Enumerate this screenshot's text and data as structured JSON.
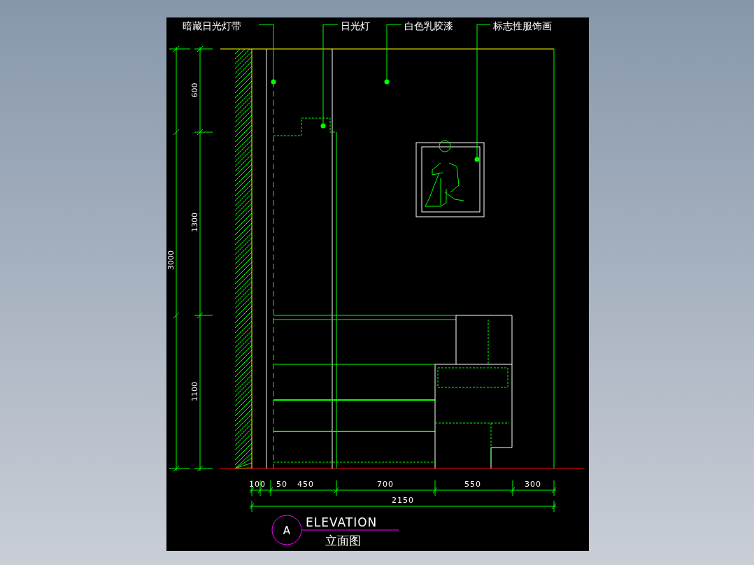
{
  "callouts": [
    {
      "label": "暗藏日光灯带"
    },
    {
      "label": "日光灯"
    },
    {
      "label": "白色乳胶漆"
    },
    {
      "label": "标志性服饰画"
    }
  ],
  "dimensions": {
    "vertical": {
      "total": "3000",
      "segments": [
        "600",
        "1300",
        "1100"
      ]
    },
    "horizontal": {
      "segments": [
        "100",
        "50",
        "450",
        "700",
        "550",
        "300"
      ],
      "total": "2150"
    }
  },
  "title_block": {
    "tag": "A",
    "title": "ELEVATION",
    "subtitle": "立面图"
  }
}
